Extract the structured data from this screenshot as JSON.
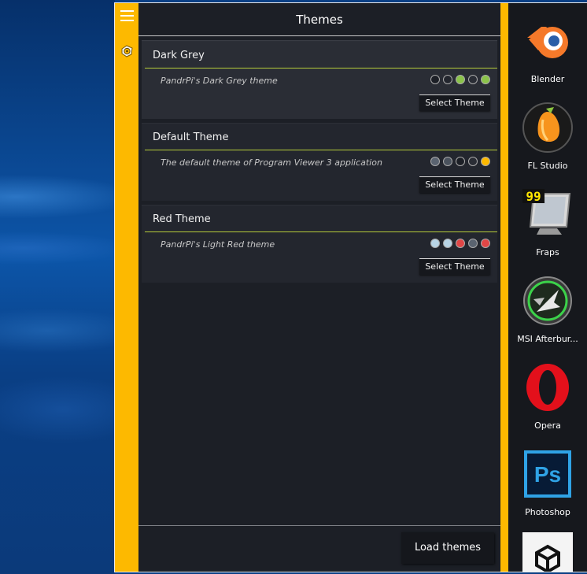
{
  "window": {
    "title": "Themes"
  },
  "themes": [
    {
      "name": "Dark Grey",
      "description": "PandrPi's Dark Grey theme",
      "button_label": "Select Theme",
      "colors": [
        "#1c1f26",
        "#23262e",
        "#8bc34a",
        "#2a2d35",
        "#8bc34a"
      ]
    },
    {
      "name": "Default Theme",
      "description": "The default theme of Program Viewer 3 application",
      "button_label": "Select Theme",
      "colors": [
        "#5a6370",
        "#4a525d",
        "#1c1f26",
        "#2a2d35",
        "#fdb900"
      ]
    },
    {
      "name": "Red Theme",
      "description": "PandrPi's Light Red theme",
      "button_label": "Select Theme",
      "colors": [
        "#b8d4e6",
        "#b8d4e6",
        "#e04646",
        "#5a6370",
        "#e04646"
      ]
    }
  ],
  "footer": {
    "load_label": "Load themes"
  },
  "apps": [
    {
      "label": "Blender",
      "icon": "blender-icon"
    },
    {
      "label": "FL Studio",
      "icon": "fl-studio-icon"
    },
    {
      "label": "Fraps",
      "icon": "fraps-icon",
      "badge": "99"
    },
    {
      "label": "MSI Afterbur...",
      "icon": "msi-afterburner-icon"
    },
    {
      "label": "Opera",
      "icon": "opera-icon"
    },
    {
      "label": "Photoshop",
      "icon": "photoshop-icon",
      "badge": "Ps"
    },
    {
      "label": "",
      "icon": "unity-icon"
    }
  ],
  "accent_color": "#fdb900"
}
